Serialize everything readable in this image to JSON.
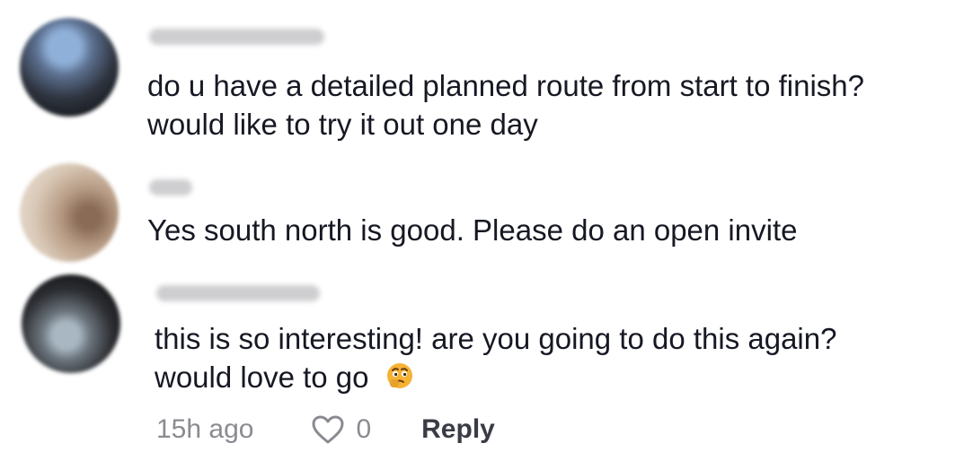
{
  "comments": [
    {
      "username": "",
      "text_line_1": "do u have a detailed planned route from start to finish?",
      "text_line_2": "would like to try it out one day"
    },
    {
      "username": "",
      "text_line_1": "Yes south north is good. Please do an open invite"
    },
    {
      "username": "",
      "text_line_1": "this is so interesting! are you going to do this again?",
      "text_line_2": "would love to go",
      "emoji": "thinking-face-icon"
    }
  ],
  "footer": {
    "time": "15h ago",
    "like_count": "0",
    "reply_label": "Reply",
    "like_icon": "heart-outline-icon"
  },
  "colors": {
    "text": "#161823",
    "meta": "#8a8b91",
    "reply": "#3a3b44"
  }
}
